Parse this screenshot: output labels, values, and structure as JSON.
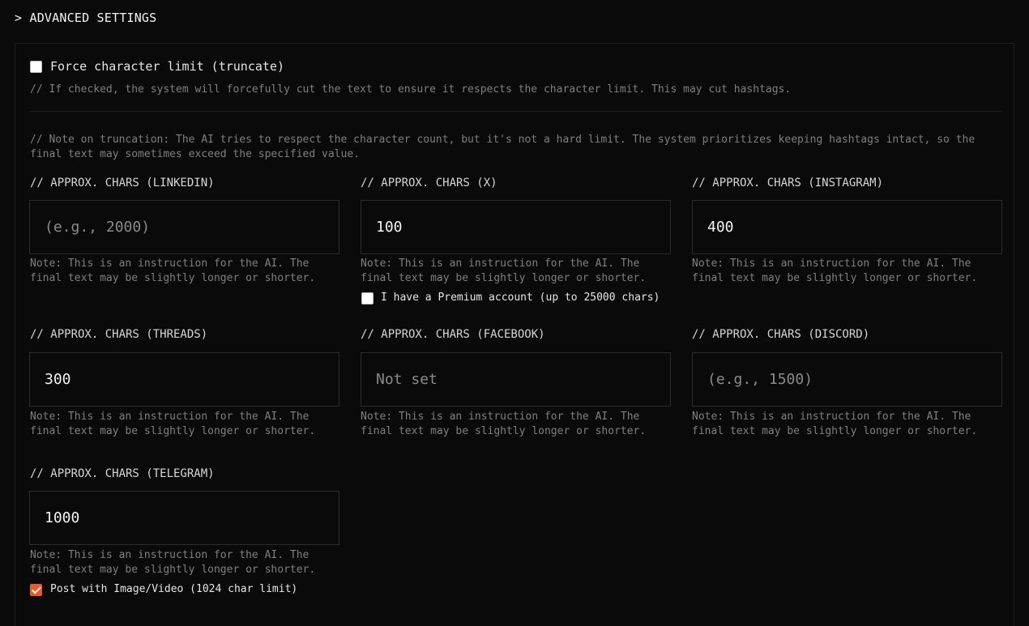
{
  "section": {
    "title": "> ADVANCED SETTINGS"
  },
  "truncate": {
    "label": "Force character limit (truncate)",
    "checked": false,
    "help": "// If checked, the system will forcefully cut the text to ensure it respects the character limit. This may cut hashtags."
  },
  "truncation_note": "// Note on truncation: The AI tries to respect the character count, but it's not a hard limit. The system prioritizes keeping hashtags intact, so the final text may sometimes exceed the specified value.",
  "fields": [
    {
      "label": "// APPROX. CHARS (LINKEDIN)",
      "value": "",
      "placeholder": "(e.g., 2000)",
      "note": "Note: This is an instruction for the AI. The final text may be slightly longer or shorter."
    },
    {
      "label": "// APPROX. CHARS (X)",
      "value": "100",
      "placeholder": "",
      "note": "Note: This is an instruction for the AI. The final text may be slightly longer or shorter."
    },
    {
      "label": "// APPROX. CHARS (INSTAGRAM)",
      "value": "400",
      "placeholder": "",
      "note": "Note: This is an instruction for the AI. The final text may be slightly longer or shorter."
    },
    {
      "label": "// APPROX. CHARS (THREADS)",
      "value": "300",
      "placeholder": "",
      "note": "Note: This is an instruction for the AI. The final text may be slightly longer or shorter."
    },
    {
      "label": "// APPROX. CHARS (FACEBOOK)",
      "value": "",
      "placeholder": "Not set",
      "note": "Note: This is an instruction for the AI. The final text may be slightly longer or shorter."
    },
    {
      "label": "// APPROX. CHARS (DISCORD)",
      "value": "",
      "placeholder": "(e.g., 1500)",
      "note": "Note: This is an instruction for the AI. The final text may be slightly longer or shorter."
    },
    {
      "label": "// APPROX. CHARS (TELEGRAM)",
      "value": "1000",
      "placeholder": "",
      "note": "Note: This is an instruction for the AI. The final text may be slightly longer or shorter."
    }
  ],
  "premium": {
    "label": "I have a Premium account (up to 25000 chars)",
    "checked": false
  },
  "media": {
    "label": "Post with Image/Video (1024 char limit)",
    "checked": true
  },
  "colors": {
    "background": "#0a0a0a",
    "accent": "#f05a22",
    "muted": "#7f7f7f",
    "border": "#2c2c2c"
  }
}
